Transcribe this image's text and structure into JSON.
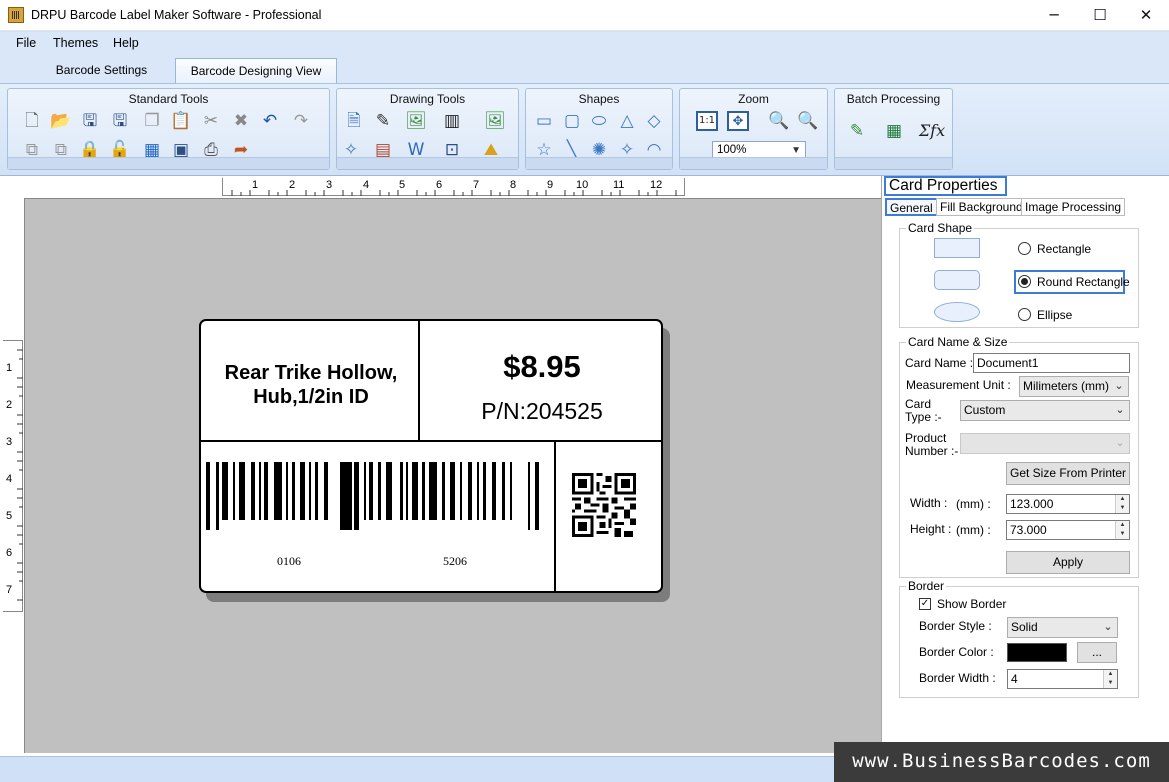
{
  "window": {
    "title": "DRPU Barcode Label Maker Software - Professional",
    "minimize_glyph": "─",
    "maximize_glyph": "☐",
    "close_glyph": "✕"
  },
  "menu": [
    "File",
    "Themes",
    "Help"
  ],
  "tabs": [
    "Barcode Settings",
    "Barcode Designing View"
  ],
  "ribbon": {
    "groups": [
      {
        "title": "Standard Tools"
      },
      {
        "title": "Drawing Tools"
      },
      {
        "title": "Shapes"
      },
      {
        "title": "Zoom",
        "zoom_value": "100%",
        "one_to_one": "1:1"
      },
      {
        "title": "Batch Processing",
        "formula_glyph": "Σfx"
      }
    ]
  },
  "ruler": {
    "h_ticks": [
      "1",
      "2",
      "3",
      "4",
      "5",
      "6",
      "7",
      "8",
      "9",
      "10",
      "11",
      "12"
    ],
    "v_ticks": [
      "1",
      "2",
      "3",
      "4",
      "5",
      "6",
      "7"
    ]
  },
  "label": {
    "product_name": "Rear Trike Hollow, Hub,1/2in  ID",
    "price": "$8.95",
    "part_number": "P/N:204525",
    "barcode_left_digits": "0106",
    "barcode_right_digits": "5206"
  },
  "panel": {
    "title": "Card Properties",
    "tabs": [
      "General",
      "Fill Background",
      "Image Processing"
    ],
    "card_shape": {
      "title": "Card Shape",
      "options": [
        "Rectangle",
        "Round Rectangle",
        "Ellipse"
      ],
      "selected": "Round Rectangle"
    },
    "card_name_size": {
      "title": "Card  Name & Size",
      "card_name_label": "Card Name :",
      "card_name_value": "Document1",
      "measurement_label": "Measurement Unit :",
      "measurement_value": "Milimeters (mm)",
      "card_type_label_1": "Card",
      "card_type_label_2": "Type :-",
      "card_type_value": "Custom",
      "product_number_label_1": "Product",
      "product_number_label_2": "Number :-",
      "get_size_button": "Get Size From Printer",
      "width_label": "Width :",
      "width_unit": "(mm) :",
      "width_value": "123.000",
      "height_label": "Height :",
      "height_unit": "(mm) :",
      "height_value": "73.000",
      "apply_button": "Apply"
    },
    "border": {
      "title": "Border",
      "show_border_label": "Show Border",
      "show_border_checked": true,
      "style_label": "Border Style :",
      "style_value": "Solid",
      "color_label": "Border Color :",
      "color_value": "#000000",
      "color_button": "...",
      "width_label": "Border Width :",
      "width_value": "4"
    }
  },
  "watermark": "www.BusinessBarcodes.com"
}
